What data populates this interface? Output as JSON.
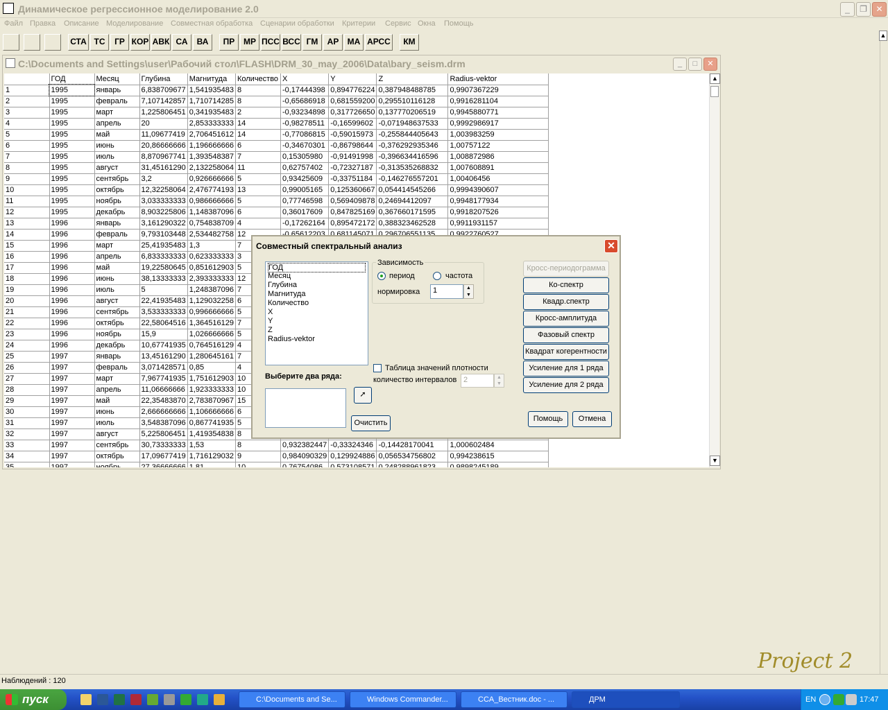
{
  "app": {
    "title": "Динамическое регрессионное моделирование 2.0",
    "menu": [
      "Файл",
      "Правка",
      "Описание",
      "Моделирование",
      "Совместная обработка",
      "Сценарии обработки",
      "Критерии",
      "Сервис",
      "Окна",
      "Помощь"
    ],
    "toolbar": [
      "СТА",
      "ТС",
      "ГР",
      "КОР",
      "АВК",
      "СА",
      "ВА",
      "ПР",
      "МР",
      "ПСС",
      "ВСС",
      "ГМ",
      "АР",
      "МА",
      "АРСС",
      "КМ"
    ]
  },
  "child": {
    "title": "C:\\Documents and Settings\\user\\Рабочий стол\\FLASH\\DRM_30_may_2006\\Data\\bary_seism.drm",
    "columns": [
      "ГОД",
      "Месяц",
      "Глубина",
      "Магнитуда",
      "Количество",
      "X",
      "Y",
      "Z",
      "Radius-vektor"
    ],
    "rows": [
      [
        "1",
        "1995",
        "январь",
        "6,838709677",
        "1,541935483",
        "8",
        "-0,17444398",
        "0,894776224",
        "0,387948488785",
        "0,9907367229"
      ],
      [
        "2",
        "1995",
        "февраль",
        "7,107142857",
        "1,710714285",
        "8",
        "-0,65686918",
        "0,681559200",
        "0,295510116128",
        "0,9916281104"
      ],
      [
        "3",
        "1995",
        "март",
        "1,225806451",
        "0,341935483",
        "2",
        "-0,93234898",
        "0,317726650",
        "0,137770206519",
        "0,9945880771"
      ],
      [
        "4",
        "1995",
        "апрель",
        "20",
        "2,853333333",
        "14",
        "-0,98278511",
        "-0,16599602",
        "-0,071948637533",
        "0,9992986917"
      ],
      [
        "5",
        "1995",
        "май",
        "11,09677419",
        "2,706451612",
        "14",
        "-0,77086815",
        "-0,59015973",
        "-0,255844405643",
        "1,003983259"
      ],
      [
        "6",
        "1995",
        "июнь",
        "20,86666666",
        "1,196666666",
        "6",
        "-0,34670301",
        "-0,86798644",
        "-0,376292935346",
        "1,00757122"
      ],
      [
        "7",
        "1995",
        "июль",
        "8,870967741",
        "1,393548387",
        "7",
        "0,15305980",
        "-0,91491998",
        "-0,396634416596",
        "1,008872986"
      ],
      [
        "8",
        "1995",
        "август",
        "31,45161290",
        "2,132258064",
        "11",
        "0,62757402",
        "-0,72327187",
        "-0,313535268832",
        "1,007608891"
      ],
      [
        "9",
        "1995",
        "сентябрь",
        "3,2",
        "0,926666666",
        "5",
        "0,93425609",
        "-0,33751184",
        "-0,146276557201",
        "1,00406456"
      ],
      [
        "10",
        "1995",
        "октябрь",
        "12,32258064",
        "2,476774193",
        "13",
        "0,99005165",
        "0,125360667",
        "0,054414545266",
        "0,9994390607"
      ],
      [
        "11",
        "1995",
        "ноябрь",
        "3,033333333",
        "0,986666666",
        "5",
        "0,77746598",
        "0,569409878",
        "0,24694412097",
        "0,9948177934"
      ],
      [
        "12",
        "1995",
        "декабрь",
        "8,903225806",
        "1,148387096",
        "6",
        "0,36017609",
        "0,847825169",
        "0,367660171595",
        "0,9918207526"
      ],
      [
        "13",
        "1996",
        "январь",
        "3,161290322",
        "0,754838709",
        "4",
        "-0,17262164",
        "0,895472172",
        "0,388323462528",
        "0,9911931157"
      ],
      [
        "14",
        "1996",
        "февраль",
        "9,793103448",
        "2,534482758",
        "12",
        "-0,65612203",
        "0,681145071",
        "0,296706551135",
        "0,9922760527"
      ],
      [
        "15",
        "1996",
        "март",
        "25,41935483",
        "1,3",
        "7",
        "",
        "",
        "",
        ""
      ],
      [
        "16",
        "1996",
        "апрель",
        "6,833333333",
        "0,623333333",
        "3",
        "",
        "",
        "",
        ""
      ],
      [
        "17",
        "1996",
        "май",
        "19,22580645",
        "0,851612903",
        "5",
        "",
        "",
        "",
        ""
      ],
      [
        "18",
        "1996",
        "июнь",
        "38,13333333",
        "2,393333333",
        "12",
        "",
        "",
        "",
        ""
      ],
      [
        "19",
        "1996",
        "июль",
        "5",
        "1,248387096",
        "7",
        "",
        "",
        "",
        ""
      ],
      [
        "20",
        "1996",
        "август",
        "22,41935483",
        "1,129032258",
        "6",
        "",
        "",
        "",
        ""
      ],
      [
        "21",
        "1996",
        "сентябрь",
        "3,533333333",
        "0,996666666",
        "5",
        "",
        "",
        "",
        ""
      ],
      [
        "22",
        "1996",
        "октябрь",
        "22,58064516",
        "1,364516129",
        "7",
        "",
        "",
        "",
        ""
      ],
      [
        "23",
        "1996",
        "ноябрь",
        "15,9",
        "1,026666666",
        "5",
        "",
        "",
        "",
        ""
      ],
      [
        "24",
        "1996",
        "декабрь",
        "10,67741935",
        "0,764516129",
        "4",
        "",
        "",
        "",
        ""
      ],
      [
        "25",
        "1997",
        "январь",
        "13,45161290",
        "1,280645161",
        "7",
        "",
        "",
        "",
        ""
      ],
      [
        "26",
        "1997",
        "февраль",
        "3,071428571",
        "0,85",
        "4",
        "",
        "",
        "",
        ""
      ],
      [
        "27",
        "1997",
        "март",
        "7,967741935",
        "1,751612903",
        "10",
        "",
        "",
        "",
        ""
      ],
      [
        "28",
        "1997",
        "апрель",
        "11,06666666",
        "1,923333333",
        "10",
        "",
        "",
        "",
        ""
      ],
      [
        "29",
        "1997",
        "май",
        "22,35483870",
        "2,783870967",
        "15",
        "",
        "",
        "",
        ""
      ],
      [
        "30",
        "1997",
        "июнь",
        "2,666666666",
        "1,106666666",
        "6",
        "",
        "",
        "",
        ""
      ],
      [
        "31",
        "1997",
        "июль",
        "3,548387096",
        "0,867741935",
        "5",
        "",
        "",
        "",
        ""
      ],
      [
        "32",
        "1997",
        "август",
        "5,225806451",
        "1,419354838",
        "8",
        "",
        "",
        "",
        ""
      ],
      [
        "33",
        "1997",
        "сентябрь",
        "30,73333333",
        "1,53",
        "8",
        "0,932382447",
        "-0,33324346",
        "-0,14428170041",
        "1,000602484"
      ],
      [
        "34",
        "1997",
        "октябрь",
        "17,09677419",
        "1,716129032",
        "9",
        "0,984090329",
        "0,129924886",
        "0,056534756802",
        "0,994238615"
      ],
      [
        "35",
        "1997",
        "ноябрь",
        "27,36666666",
        "1,81",
        "10",
        "0,76754086",
        "0,573108571",
        "0,248288961823",
        "0,9898245189"
      ]
    ]
  },
  "dialog": {
    "title": "Совместный спектральный анализ",
    "series": [
      "ГОД",
      "Месяц",
      "Глубина",
      "Магнитуда",
      "Количество",
      "X",
      "Y",
      "Z",
      "Radius-vektor"
    ],
    "choose_label": "Выберите два ряда:",
    "dependency_label": "Зависимость",
    "radio_period": "период",
    "radio_frequency": "частота",
    "normalization_label": "нормировка",
    "normalization_value": "1",
    "density_table_label": "Таблица значений плотности",
    "intervals_label": "количество интервалов",
    "intervals_value": "2",
    "clear_button": "Очистить",
    "buttons": [
      "Кросс-периодограмма",
      "Ко-спектр",
      "Квадр.спектр",
      "Кросс-амплитуда",
      "Фазовый спектр",
      "Квадрат когерентности",
      "Усиление для 1 ряда",
      "Усиление для 2 ряда"
    ],
    "help_button": "Помощь",
    "cancel_button": "Отмена"
  },
  "status": {
    "observations": "Наблюдений : 120"
  },
  "watermark": "Project 2",
  "taskbar": {
    "start": "пуск",
    "tasks": [
      "C:\\Documents and Se...",
      "Windows Commander...",
      "CCA_Вестник.doc - ...",
      "ДРМ"
    ],
    "lang": "EN",
    "clock": "17:47"
  }
}
